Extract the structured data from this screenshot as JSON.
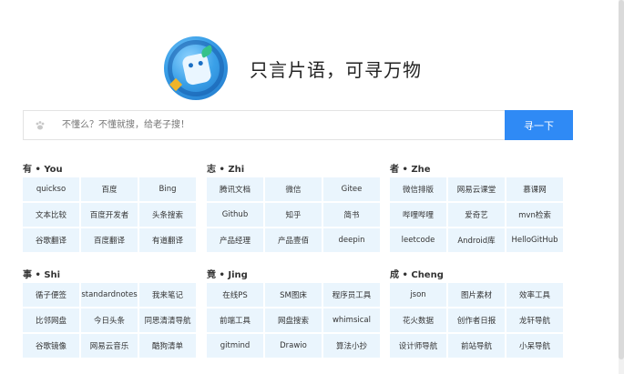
{
  "hero": {
    "title": "只言片语，可寻万物"
  },
  "search": {
    "placeholder": "不懂么？不懂就搜，给老子搜！",
    "button": "寻一下",
    "icon": "paw-icon"
  },
  "groups": [
    {
      "title": "有 • You",
      "items": [
        "quickso",
        "百度",
        "Bing",
        "文本比较",
        "百度开发者",
        "头条搜索",
        "谷歌翻译",
        "百度翻译",
        "有道翻译"
      ]
    },
    {
      "title": "志 • Zhi",
      "items": [
        "腾讯文档",
        "微信",
        "Gitee",
        "Github",
        "知乎",
        "简书",
        "产品经理",
        "产品壹佰",
        "deepin"
      ]
    },
    {
      "title": "者 • Zhe",
      "items": [
        "微信排版",
        "网易云课堂",
        "慕课网",
        "哔哩哔哩",
        "爱奇艺",
        "mvn检索",
        "leetcode",
        "Android库",
        "HelloGitHub"
      ]
    },
    {
      "title": "事 • Shi",
      "items": [
        "循子便签",
        "standardnotes",
        "我来笔记",
        "比邻网盘",
        "今日头条",
        "同思清清导航",
        "谷歌镜像",
        "网易云音乐",
        "酷狗清单"
      ]
    },
    {
      "title": "竟 • Jing",
      "items": [
        "在线PS",
        "SM图床",
        "程序员工具",
        "前端工具",
        "网盘搜索",
        "whimsical",
        "gitmind",
        "Drawio",
        "算法小抄"
      ]
    },
    {
      "title": "成 • Cheng",
      "items": [
        "json",
        "图片素材",
        "效率工具",
        "花火数据",
        "创作者日报",
        "龙轩导航",
        "设计师导航",
        "前站导航",
        "小呆导航"
      ]
    }
  ]
}
